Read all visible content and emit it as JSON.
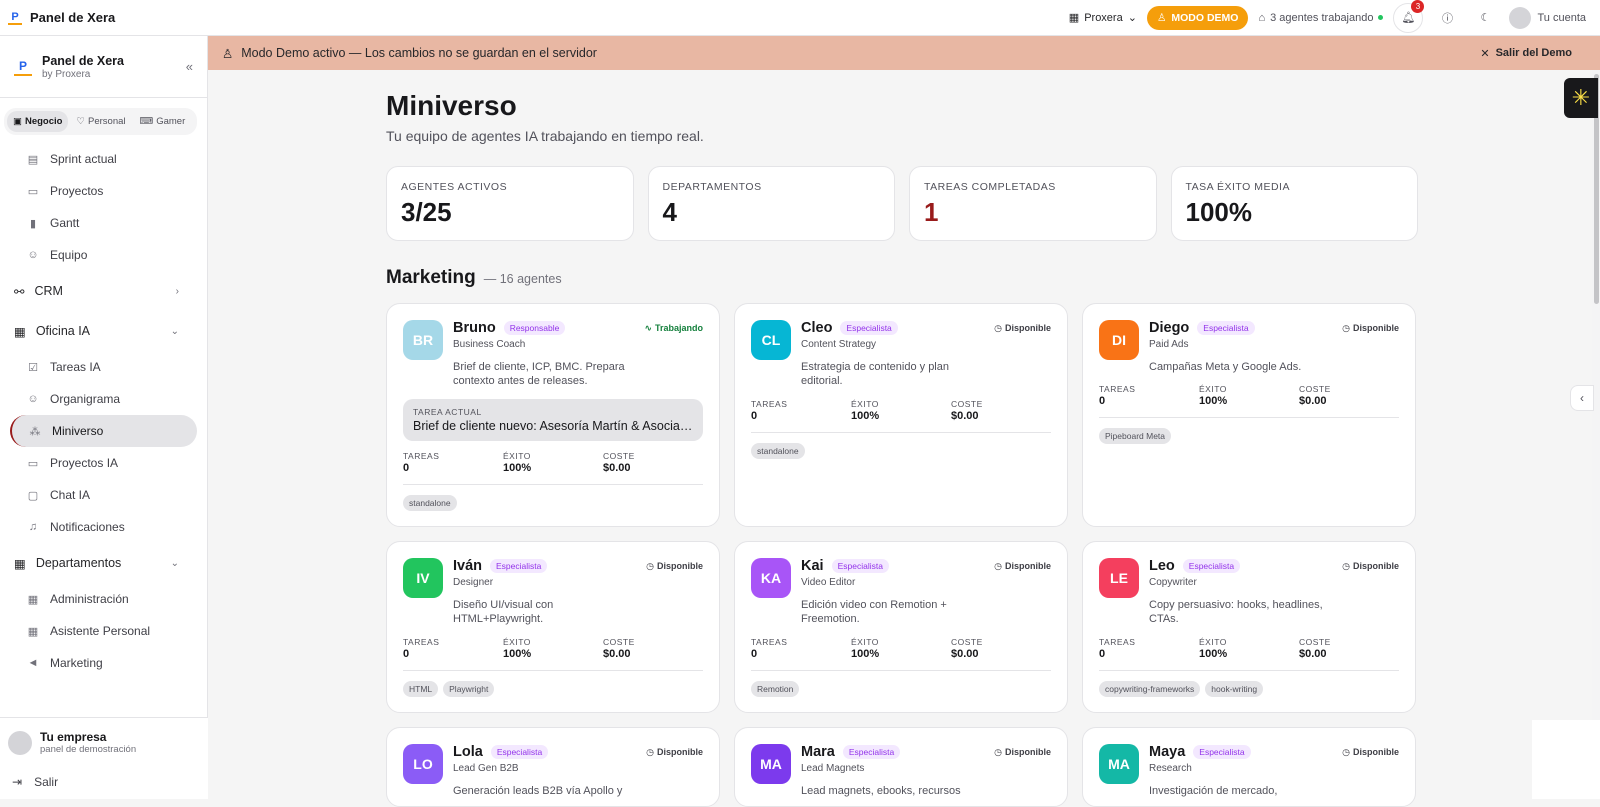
{
  "topbar": {
    "app_title": "Panel de Xera",
    "org_name": "Proxera",
    "demo_button": "MODO DEMO",
    "agents_working": "3 agentes trabajando",
    "notif_count": "3",
    "account_label": "Tu cuenta"
  },
  "sidebar": {
    "title": "Panel de Xera",
    "subtitle": "by Proxera",
    "modes": [
      "Negocio",
      "Personal",
      "Gamer"
    ],
    "items_top": [
      {
        "label": "Sprint actual",
        "icon": "calendar-icon"
      },
      {
        "label": "Proyectos",
        "icon": "folder-icon"
      },
      {
        "label": "Gantt",
        "icon": "bar-chart-icon"
      },
      {
        "label": "Equipo",
        "icon": "users-icon"
      }
    ],
    "groups": {
      "crm": "CRM",
      "oficina": "Oficina IA",
      "departamentos": "Departamentos"
    },
    "items_oficina": [
      {
        "label": "Tareas IA",
        "icon": "check-square-icon"
      },
      {
        "label": "Organigrama",
        "icon": "users-icon"
      },
      {
        "label": "Miniverso",
        "icon": "network-icon"
      },
      {
        "label": "Proyectos IA",
        "icon": "folder-icon"
      },
      {
        "label": "Chat IA",
        "icon": "chat-icon"
      },
      {
        "label": "Notificaciones",
        "icon": "bell-icon"
      }
    ],
    "items_departamentos": [
      {
        "label": "Administración",
        "icon": "building-icon"
      },
      {
        "label": "Asistente Personal",
        "icon": "building-icon"
      },
      {
        "label": "Marketing",
        "icon": "megaphone-icon"
      }
    ],
    "company_name": "Tu empresa",
    "company_sub": "panel de demostración",
    "logout": "Salir"
  },
  "banner": {
    "text": "Modo Demo activo — Los cambios no se guardan en el servidor",
    "exit": "Salir del Demo"
  },
  "page": {
    "title": "Miniverso",
    "subtitle": "Tu equipo de agentes IA trabajando en tiempo real."
  },
  "stats": [
    {
      "label": "AGENTES ACTIVOS",
      "value": "3/25"
    },
    {
      "label": "DEPARTAMENTOS",
      "value": "4"
    },
    {
      "label": "TAREAS COMPLETADAS",
      "value": "1"
    },
    {
      "label": "TASA ÉXITO MEDIA",
      "value": "100%"
    }
  ],
  "section": {
    "title": "Marketing",
    "count": "— 16 agentes"
  },
  "metric_labels": {
    "tasks": "TAREAS",
    "success": "ÉXITO",
    "cost": "COSTE"
  },
  "task_label": "TAREA ACTUAL",
  "agents": [
    {
      "initials": "BR",
      "name": "Bruno",
      "role": "Responsable",
      "status": "Trabajando",
      "title": "Business Coach",
      "desc": "Brief de cliente, ICP, BMC. Prepara contexto antes de releases.",
      "task": "Brief de cliente nuevo: Asesoría Martín & Asociados",
      "tareas": "0",
      "exito": "100%",
      "coste": "$0.00",
      "tags": [
        "standalone"
      ],
      "color": "#a5d8e8"
    },
    {
      "initials": "CL",
      "name": "Cleo",
      "role": "Especialista",
      "status": "Disponible",
      "title": "Content Strategy",
      "desc": "Estrategia de contenido y plan editorial.",
      "tareas": "0",
      "exito": "100%",
      "coste": "$0.00",
      "tags": [
        "standalone"
      ],
      "color": "#06b6d4"
    },
    {
      "initials": "DI",
      "name": "Diego",
      "role": "Especialista",
      "status": "Disponible",
      "title": "Paid Ads",
      "desc": "Campañas Meta y Google Ads.",
      "tareas": "0",
      "exito": "100%",
      "coste": "$0.00",
      "tags": [
        "Pipeboard Meta"
      ],
      "color": "#f97316"
    },
    {
      "initials": "IV",
      "name": "Iván",
      "role": "Especialista",
      "status": "Disponible",
      "title": "Designer",
      "desc": "Diseño UI/visual con HTML+Playwright.",
      "tareas": "0",
      "exito": "100%",
      "coste": "$0.00",
      "tags": [
        "HTML",
        "Playwright"
      ],
      "color": "#22c55e"
    },
    {
      "initials": "KA",
      "name": "Kai",
      "role": "Especialista",
      "status": "Disponible",
      "title": "Video Editor",
      "desc": "Edición video con Remotion + Freemotion.",
      "tareas": "0",
      "exito": "100%",
      "coste": "$0.00",
      "tags": [
        "Remotion"
      ],
      "color": "#a855f7"
    },
    {
      "initials": "LE",
      "name": "Leo",
      "role": "Especialista",
      "status": "Disponible",
      "title": "Copywriter",
      "desc": "Copy persuasivo: hooks, headlines, CTAs.",
      "tareas": "0",
      "exito": "100%",
      "coste": "$0.00",
      "tags": [
        "copywriting-frameworks",
        "hook-writing"
      ],
      "color": "#f43f5e"
    },
    {
      "initials": "LO",
      "name": "Lola",
      "role": "Especialista",
      "status": "Disponible",
      "title": "Lead Gen B2B",
      "desc": "Generación leads B2B vía Apollo y",
      "color": "#8b5cf6"
    },
    {
      "initials": "MA",
      "name": "Mara",
      "role": "Especialista",
      "status": "Disponible",
      "title": "Lead Magnets",
      "desc": "Lead magnets, ebooks, recursos",
      "color": "#7c3aed"
    },
    {
      "initials": "MA",
      "name": "Maya",
      "role": "Especialista",
      "status": "Disponible",
      "title": "Research",
      "desc": "Investigación de mercado,",
      "color": "#14b8a6"
    }
  ]
}
